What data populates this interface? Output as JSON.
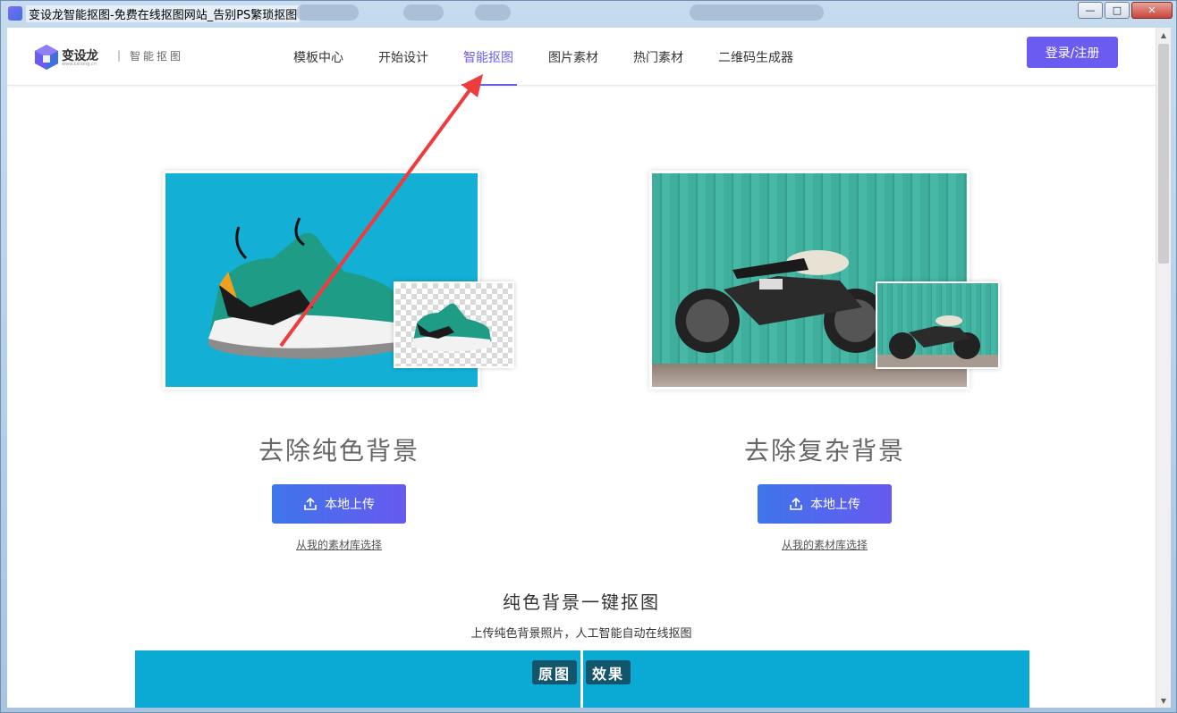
{
  "window": {
    "title": "变设龙智能抠图-免费在线抠图网站_告别PS繁琐抠图",
    "controls": {
      "minimize": "—",
      "maximize": "□",
      "close": "✕"
    }
  },
  "header": {
    "logo_name": "变设龙",
    "logo_url": "www.bsilong.cn",
    "separator": "|",
    "logo_sub": "智能抠图",
    "nav": [
      {
        "label": "模板中心",
        "active": false
      },
      {
        "label": "开始设计",
        "active": false
      },
      {
        "label": "智能抠图",
        "active": true
      },
      {
        "label": "图片素材",
        "active": false
      },
      {
        "label": "热门素材",
        "active": false
      },
      {
        "label": "二维码生成器",
        "active": false
      }
    ],
    "login_label": "登录/注册"
  },
  "cards": {
    "left": {
      "title": "去除纯色背景",
      "upload_label": "本地上传",
      "library_link": "从我的素材库选择"
    },
    "right": {
      "title": "去除复杂背景",
      "upload_label": "本地上传",
      "library_link": "从我的素材库选择"
    }
  },
  "section": {
    "title": "纯色背景一键抠图",
    "subtitle": "上传纯色背景照片，人工智能自动在线抠图",
    "tag_before": "原图",
    "tag_after": "效果"
  },
  "colors": {
    "accent": "#6b5cf1",
    "annotation_arrow": "#ef3b3b",
    "demo_blue": "#13afd5"
  }
}
